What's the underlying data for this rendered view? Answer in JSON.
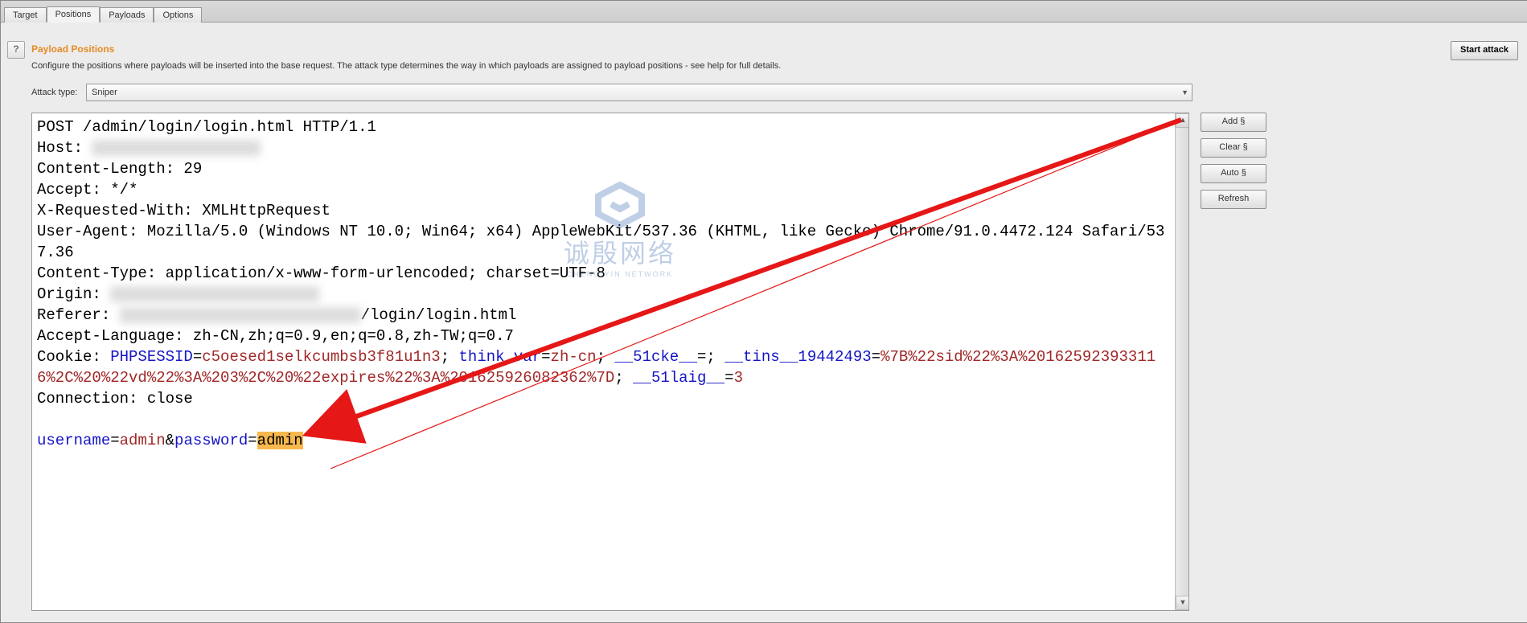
{
  "tabs": {
    "target": "Target",
    "positions": "Positions",
    "payloads": "Payloads",
    "options": "Options"
  },
  "section": {
    "title": "Payload Positions",
    "desc": "Configure the positions where payloads will be inserted into the base request. The attack type determines the way in which payloads are assigned to payload positions - see help for full details."
  },
  "attack": {
    "label": "Attack type:",
    "value": "Sniper"
  },
  "buttons": {
    "start": "Start attack",
    "add": "Add §",
    "clear": "Clear §",
    "auto": "Auto §",
    "refresh": "Refresh",
    "help": "?"
  },
  "request": {
    "line1": "POST /admin/login/login.html HTTP/1.1",
    "host_label": "Host: ",
    "clen": "Content-Length: 29",
    "accept": "Accept: */*",
    "xrw": "X-Requested-With: XMLHttpRequest",
    "ua": "User-Agent: Mozilla/5.0 (Windows NT 10.0; Win64; x64) AppleWebKit/537.36 (KHTML, like Gecko) Chrome/91.0.4472.124 Safari/537.36",
    "ctype": "Content-Type: application/x-www-form-urlencoded; charset=UTF-8",
    "origin_label": "Origin: ",
    "referer": "/login/login.html",
    "referer_label": "Referer: ",
    "alang": "Accept-Language: zh-CN,zh;q=0.9,en;q=0.8,zh-TW;q=0.7",
    "cookie_label": "Cookie: ",
    "ck1_name": "PHPSESSID",
    "ck1_val": "c5oesed1selkcumbsb3f81u1n3",
    "ck2_name": "think_var",
    "ck2_val": "zh-cn",
    "ck3_name": "__51cke__",
    "ck4_name": "__tins__19442493",
    "ck4_val": "%7B%22sid%22%3A%201625923933116%2C%20%22vd%22%3A%203%2C%20%22expires%22%3A%201625926082362%7D",
    "ck5_name": "__51laig__",
    "ck5_val": "3",
    "conn": "Connection: close",
    "body_user": "username",
    "body_userv": "admin",
    "body_amp": "&",
    "body_pass": "password",
    "body_passv": "admin"
  },
  "watermark": {
    "cn": "诚殷网络",
    "en": "CHENG YIN NETWORK"
  }
}
